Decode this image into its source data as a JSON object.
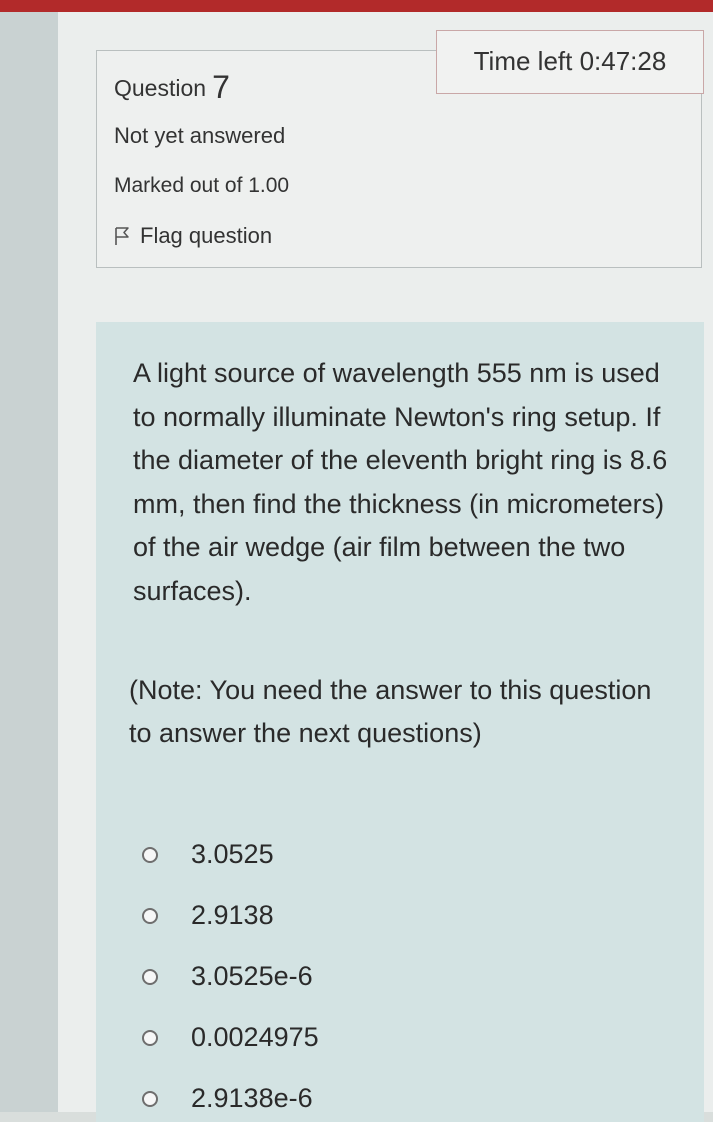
{
  "timer": {
    "text": "Time left 0:47:28"
  },
  "question_info": {
    "label": "Question",
    "number": "7",
    "state": "Not yet answered",
    "grade": "Marked out of 1.00",
    "flag_label": "Flag question"
  },
  "question": {
    "text": "A light source of wavelength 555 nm is used to normally illuminate Newton's ring setup. If the diameter of the eleventh bright ring is 8.6 mm, then find the thickness (in micrometers) of the air wedge (air film between the two surfaces).",
    "note": "(Note: You need the answer to this question to answer the next questions)"
  },
  "options": [
    {
      "label": "3.0525"
    },
    {
      "label": "2.9138"
    },
    {
      "label": "3.0525e-6"
    },
    {
      "label": "0.0024975"
    },
    {
      "label": "2.9138e-6"
    }
  ],
  "colors": {
    "top_strip": "#b22a2a",
    "question_panel": "#d3e3e3",
    "page": "#ebeeed"
  }
}
